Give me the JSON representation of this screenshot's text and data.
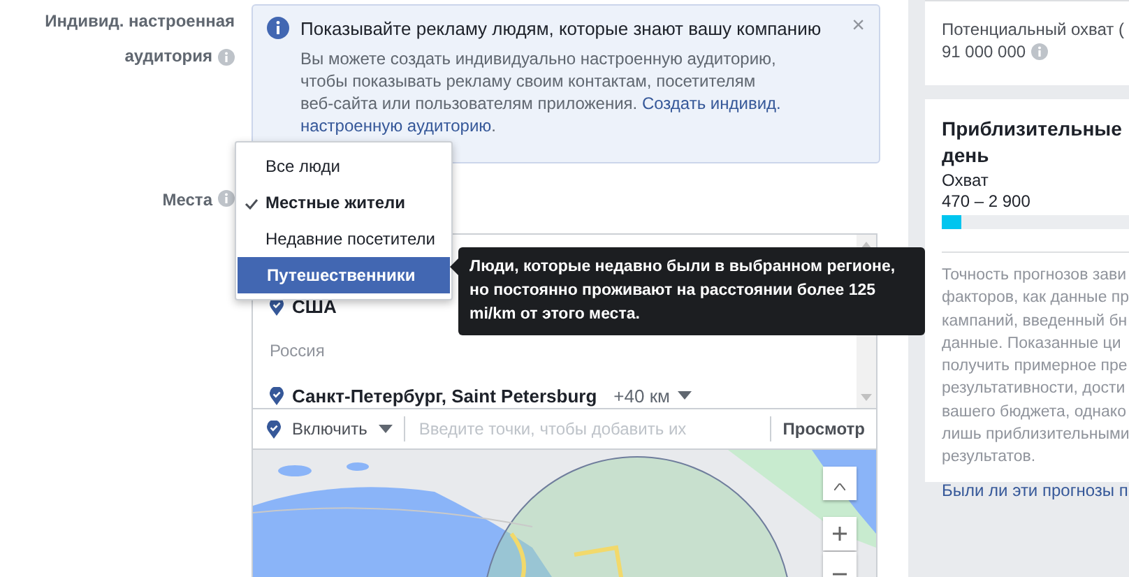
{
  "audience": {
    "label_lines": [
      "Индивид. настроенная",
      "аудитория"
    ],
    "notice": {
      "title": "Показывайте рекламу людям, которые знают вашу компанию",
      "body": "Вы можете создать индивидуально настроенную аудиторию, чтобы показывать рекламу своим контактам, посетителям веб-сайта или пользователям приложения.",
      "link_lines": [
        "Создать индивид.",
        "настроенную аудиторию"
      ],
      "end": ".",
      "close": "×"
    }
  },
  "places": {
    "label": "Места",
    "menu": [
      {
        "label": "Все люди",
        "checked": false,
        "selected": false
      },
      {
        "label": "Местные жители",
        "checked": true,
        "selected": false
      },
      {
        "label": "Недавние посетители",
        "checked": false,
        "selected": false
      },
      {
        "label": "Путешественники",
        "checked": false,
        "selected": true
      }
    ],
    "tooltip": "Люди, которые недавно были в выбранном регионе, но постоянно проживают на расстоянии более 125 mi/km от этого места.",
    "locations": [
      {
        "kind": "place",
        "name": "США"
      },
      {
        "kind": "group",
        "name": "Россия"
      },
      {
        "kind": "place",
        "name": "Санкт-Петербург, Saint Petersburg",
        "radius": "+40 км"
      }
    ],
    "mode": "Включить",
    "input": {
      "placeholder": "Введите точки, чтобы добавить их"
    },
    "browse": "Просмотр"
  },
  "reach": {
    "label": "Потенциальный охват (",
    "value": "91 000 000"
  },
  "estimate": {
    "title_lines": [
      "Приблизительные",
      "день"
    ],
    "metric": "Охват",
    "range": "470 – 2 900",
    "level": 0.07,
    "note_lines": [
      "Точность прогнозов зави",
      "факторов, как данные пр",
      "кампаний, введенный бн",
      "данные. Показанные ци",
      "получить примерное пре",
      "результативности, дости",
      "вашего бюджета, однако",
      "лишь приблизительными",
      "результатов."
    ],
    "feedback": "Были ли эти прогнозы п"
  }
}
